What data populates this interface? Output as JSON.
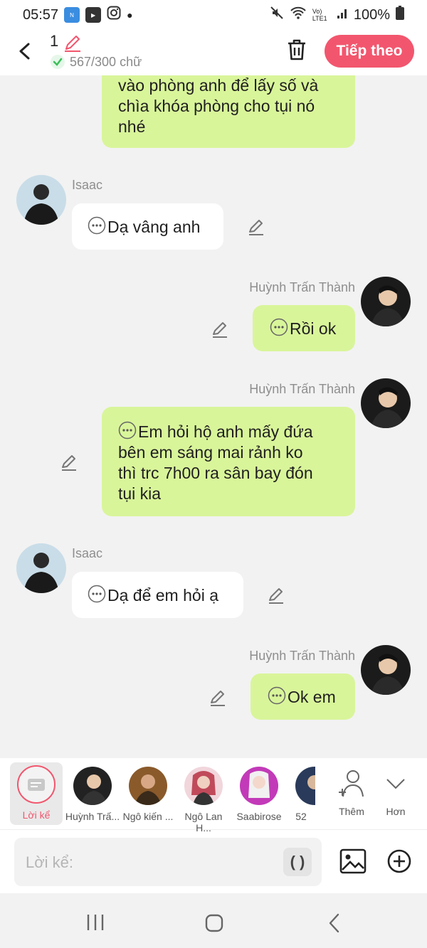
{
  "status": {
    "time": "05:57",
    "battery": "100%",
    "volte": "Vo) LTE1"
  },
  "header": {
    "title_number": "1",
    "char_count": "567/300 chữ",
    "next_button": "Tiếp theo"
  },
  "messages": [
    {
      "speaker": "",
      "side": "right",
      "lines": [
        "vào phòng anh để lấy số và",
        "chìa khóa phòng cho tụi nó",
        "nhé"
      ]
    },
    {
      "speaker": "Isaac",
      "side": "left",
      "text": "Dạ vâng anh"
    },
    {
      "speaker": "Huỳnh Trấn Thành",
      "side": "right",
      "text": "Rồi ok"
    },
    {
      "speaker": "Huỳnh Trấn Thành",
      "side": "right",
      "lines": [
        "Em hỏi hộ anh mấy đứa",
        "bên em sáng mai rảnh ko",
        "thì trc 7h00 ra sân bay đón",
        "tụi kia"
      ]
    },
    {
      "speaker": "Isaac",
      "side": "left",
      "text": "Dạ để em hỏi ạ"
    },
    {
      "speaker": "Huỳnh Trấn Thành",
      "side": "right",
      "text": "Ok em"
    }
  ],
  "characters": {
    "narrator": "Lời kể",
    "list": [
      "Huỳnh Trấ...",
      "Ngô kiến ...",
      "Ngô Lan H...",
      "Saabirose",
      "52"
    ],
    "more": "Thêm",
    "expand": "Hơn"
  },
  "input": {
    "placeholder": "Lời kể:",
    "paren": "( )"
  },
  "colors": {
    "accent": "#f2566e",
    "bubble_green": "#d9f59a",
    "bubble_white": "#ffffff"
  }
}
